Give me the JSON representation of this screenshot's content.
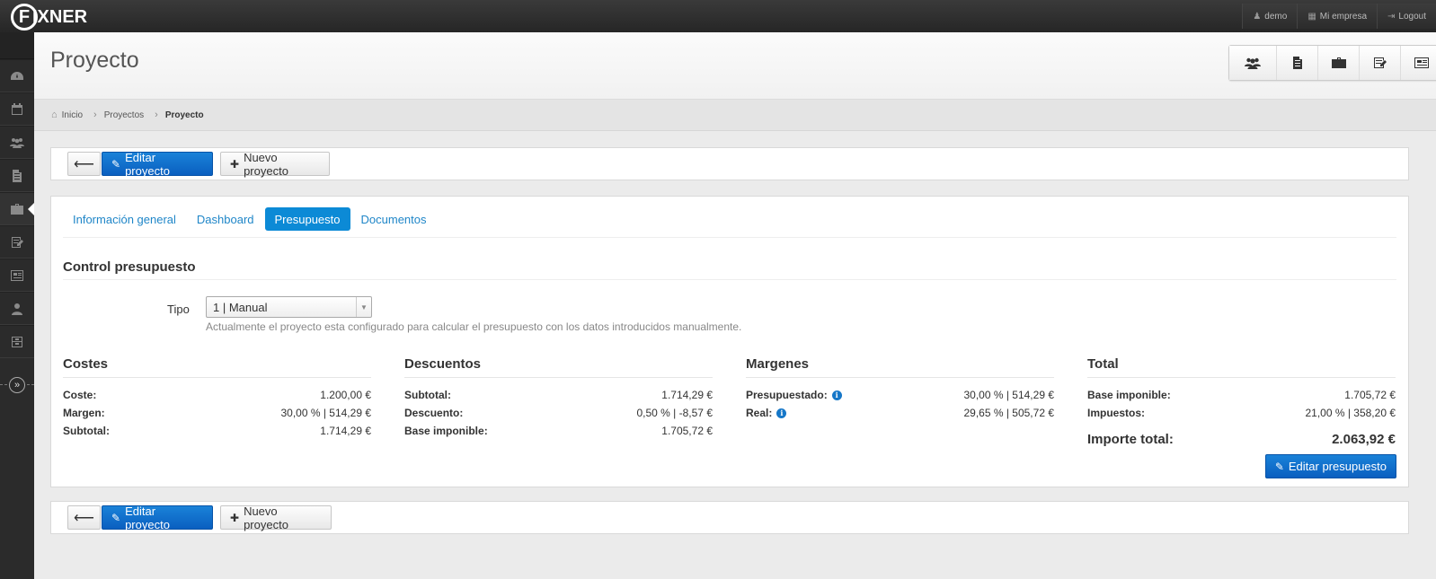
{
  "app": {
    "logo_text": "IXNER",
    "logo_mark": "F"
  },
  "topnav": [
    {
      "label": "demo",
      "icon": "user-icon"
    },
    {
      "label": "Mi empresa",
      "icon": "building-icon"
    },
    {
      "label": "Logout",
      "icon": "logout-icon"
    }
  ],
  "page": {
    "title": "Proyecto"
  },
  "breadcrumb": {
    "home": "Inicio",
    "level1": "Proyectos",
    "current": "Proyecto"
  },
  "toolbar": {
    "back_icon": "⟵",
    "edit_label": "Editar proyecto",
    "new_label": "Nuevo proyecto"
  },
  "tabs": [
    "Información general",
    "Dashboard",
    "Presupuesto",
    "Documentos"
  ],
  "active_tab": "Presupuesto",
  "section": {
    "title": "Control presupuesto",
    "tipo_label": "Tipo",
    "tipo_value": "1 | Manual",
    "tipo_help": "Actualmente el proyecto esta configurado para calcular el presupuesto con los datos introducidos manualmente."
  },
  "costes": {
    "title": "Costes",
    "rows": [
      {
        "label": "Coste:",
        "value": "1.200,00 €"
      },
      {
        "label": "Margen:",
        "value": "30,00 % | 514,29 €"
      },
      {
        "label": "Subtotal:",
        "value": "1.714,29 €"
      }
    ]
  },
  "descuentos": {
    "title": "Descuentos",
    "rows": [
      {
        "label": "Subtotal:",
        "value": "1.714,29 €"
      },
      {
        "label": "Descuento:",
        "value": "0,50 % | -8,57 €"
      },
      {
        "label": "Base imponible:",
        "value": "1.705,72 €"
      }
    ]
  },
  "margenes": {
    "title": "Margenes",
    "rows": [
      {
        "label": "Presupuestado:",
        "value": "30,00 % | 514,29 €"
      },
      {
        "label": "Real:",
        "value": "29,65 % | 505,72 €"
      }
    ]
  },
  "total": {
    "title": "Total",
    "rows": [
      {
        "label": "Base imponible:",
        "value": "1.705,72 €"
      },
      {
        "label": "Impuestos:",
        "value": "21,00 % | 358,20 €"
      }
    ],
    "importe_label": "Importe total:",
    "importe_value": "2.063,92 €",
    "edit_label": "Editar presupuesto"
  },
  "colors": {
    "primary": "#0a6fd0",
    "tab_active": "#0c8ad6",
    "link": "#1f86c8"
  }
}
